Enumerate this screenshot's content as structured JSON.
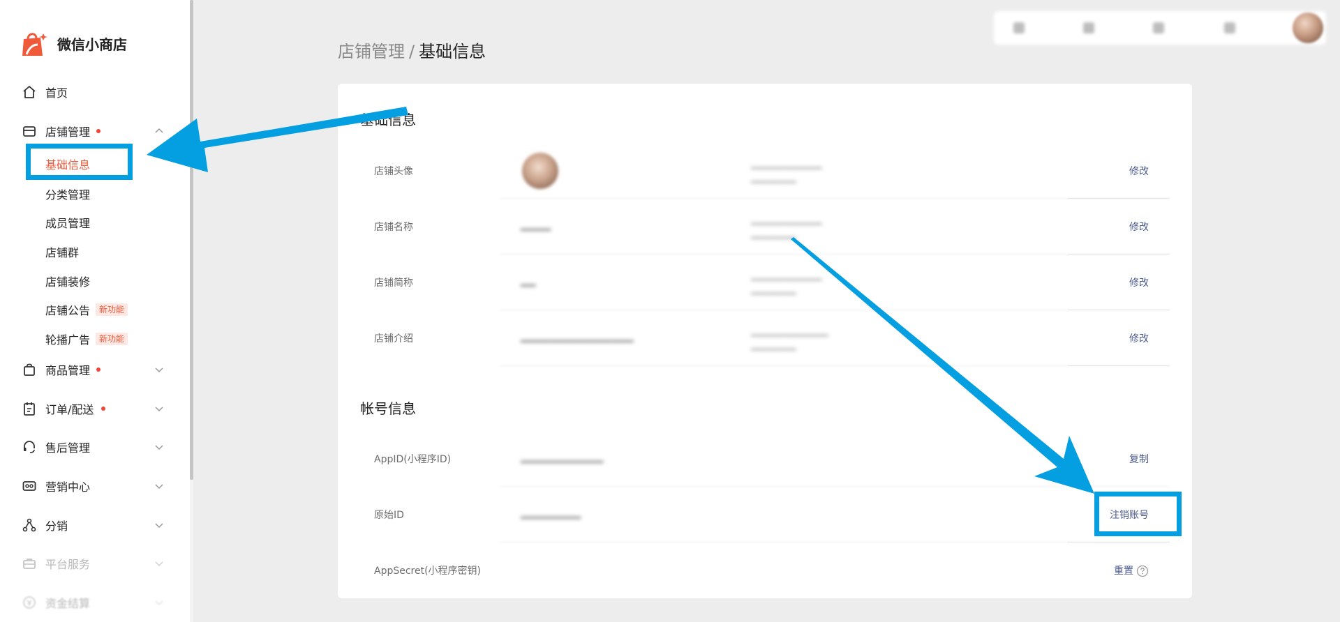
{
  "app": {
    "name": "微信小商店"
  },
  "sidebar": {
    "items": [
      {
        "label": "首页",
        "icon": "home-icon"
      },
      {
        "label": "店铺管理",
        "icon": "store-icon",
        "has_dot": true,
        "expanded": true,
        "children": [
          {
            "label": "基础信息",
            "active": true
          },
          {
            "label": "分类管理"
          },
          {
            "label": "成员管理"
          },
          {
            "label": "店铺群"
          },
          {
            "label": "店铺装修"
          },
          {
            "label": "店铺公告",
            "badge": "新功能"
          },
          {
            "label": "轮播广告",
            "badge": "新功能"
          }
        ]
      },
      {
        "label": "商品管理",
        "icon": "bag-icon",
        "has_dot": true
      },
      {
        "label": "订单/配送",
        "icon": "order-icon",
        "has_dot": true
      },
      {
        "label": "售后管理",
        "icon": "headset-icon"
      },
      {
        "label": "营销中心",
        "icon": "ticket-icon"
      },
      {
        "label": "分销",
        "icon": "share-icon"
      },
      {
        "label": "平台服务",
        "icon": "briefcase-icon",
        "disabled": true
      },
      {
        "label": "资金结算",
        "icon": "coin-icon",
        "disabled": true
      }
    ]
  },
  "breadcrumb": {
    "parent": "店铺管理",
    "separator": "/",
    "current": "基础信息"
  },
  "basic_section": {
    "title": "基础信息",
    "rows": [
      {
        "label": "店铺头像",
        "action": "修改"
      },
      {
        "label": "店铺名称",
        "action": "修改"
      },
      {
        "label": "店铺简称",
        "action": "修改"
      },
      {
        "label": "店铺介绍",
        "action": "修改"
      }
    ]
  },
  "account_section": {
    "title": "帐号信息",
    "rows": [
      {
        "label": "AppID(小程序ID)",
        "action": "复制"
      },
      {
        "label": "原始ID",
        "action": "注销账号"
      },
      {
        "label": "AppSecret(小程序密钥)",
        "action": "重置"
      }
    ]
  },
  "colors": {
    "accent": "#f05a3b",
    "annotation": "#039fe1",
    "link": "#4b5a8c"
  }
}
